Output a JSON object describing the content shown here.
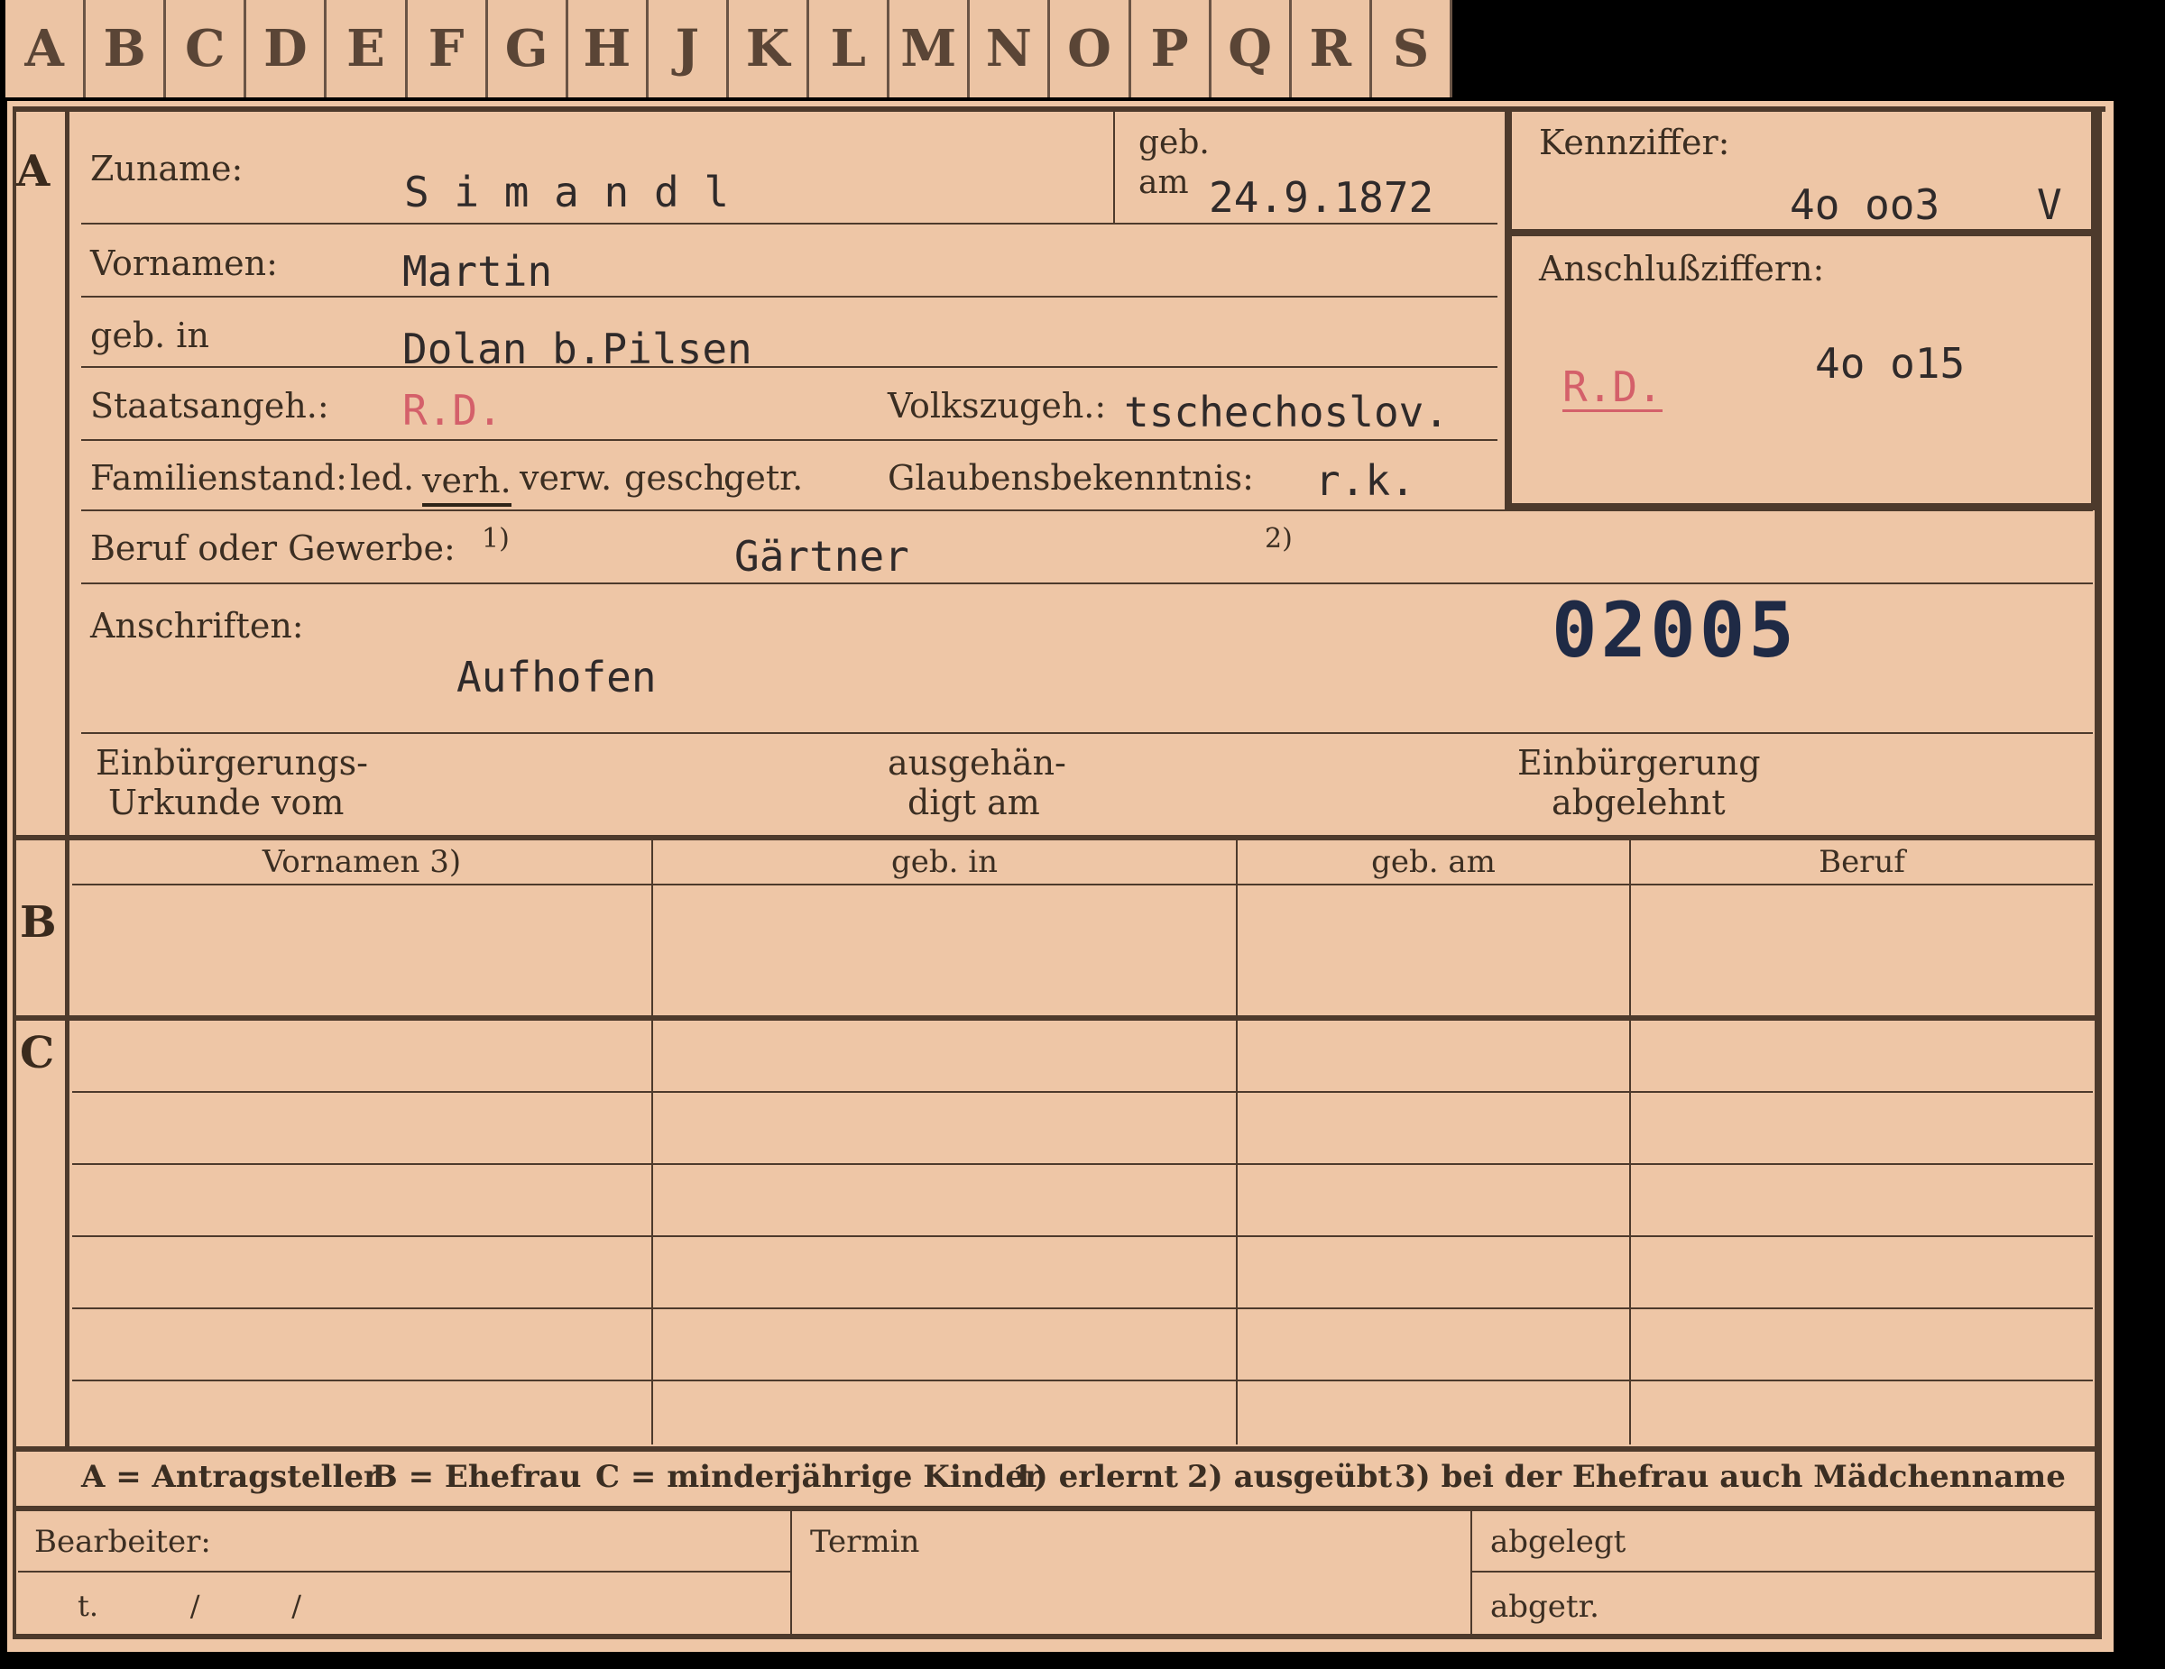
{
  "index_tabs": [
    "A",
    "B",
    "C",
    "D",
    "E",
    "F",
    "G",
    "H",
    "J",
    "K",
    "L",
    "M",
    "N",
    "O",
    "P",
    "Q",
    "R",
    "S"
  ],
  "sections": {
    "a": "A",
    "b": "B",
    "c": "C"
  },
  "labels": {
    "zuname": "Zuname:",
    "geb": "geb.",
    "am": "am",
    "vornamen": "Vornamen:",
    "geb_in": "geb. in",
    "staatsangeh": "Staatsangeh.:",
    "volkszugeh": "Volkszugeh.:",
    "familienstand": "Familienstand:",
    "fam_options": {
      "led": "led.",
      "verh": "verh.",
      "verw": "verw.",
      "gesch": "gesch.",
      "getr": "getr."
    },
    "glaubensbekenntnis": "Glaubensbekenntnis:",
    "beruf_oder_gewerbe": "Beruf oder Gewerbe:",
    "footnote1": "1)",
    "footnote2": "2)",
    "anschriften": "Anschriften:",
    "einb_urkunde_1": "Einbürgerungs-",
    "einb_urkunde_2": "Urkunde vom",
    "ausgehaen_1": "ausgehän-",
    "ausgehaen_2": "digt am",
    "einb_abgelehnt_1": "Einbürgerung",
    "einb_abgelehnt_2": "abgelehnt",
    "kennziffer": "Kennziffer:",
    "anschlussziffern": "Anschlußziffern:"
  },
  "values": {
    "surname": "S i m a n d l",
    "birth_date": "24.9.1872",
    "first_names": "Martin",
    "birth_place": "Dolan b.Pilsen",
    "citizenship": "R.D.",
    "ethnicity": "tschechoslov.",
    "religion": "r.k.",
    "occupation": "Gärtner",
    "address": "Aufhofen",
    "kennziffer": "4o oo3",
    "kennziffer_suffix": "V",
    "anschluss_code": "R.D.",
    "anschluss_number": "4o o15",
    "stamp_number": "02005"
  },
  "table_b_headers": [
    "Vornamen 3)",
    "geb. in",
    "geb. am",
    "Beruf"
  ],
  "legend": {
    "a": "A = Antragsteller",
    "b": "B = Ehefrau",
    "c": "C = minderjährige Kinder",
    "f1": "1) erlernt",
    "f2": "2) ausgeübt",
    "f3": "3) bei der Ehefrau auch Mädchenname"
  },
  "bottom": {
    "bearbeiter": "Bearbeiter:",
    "bearbeiter_line": "t.          /          /",
    "termin": "Termin",
    "abgelegt": "abgelegt",
    "abgetr": "abgetr."
  },
  "colors": {
    "card": "#eec6a6",
    "ink": "#2e2418",
    "stamp_red": "#d4606a",
    "stamp_blue": "#1f2a45"
  }
}
